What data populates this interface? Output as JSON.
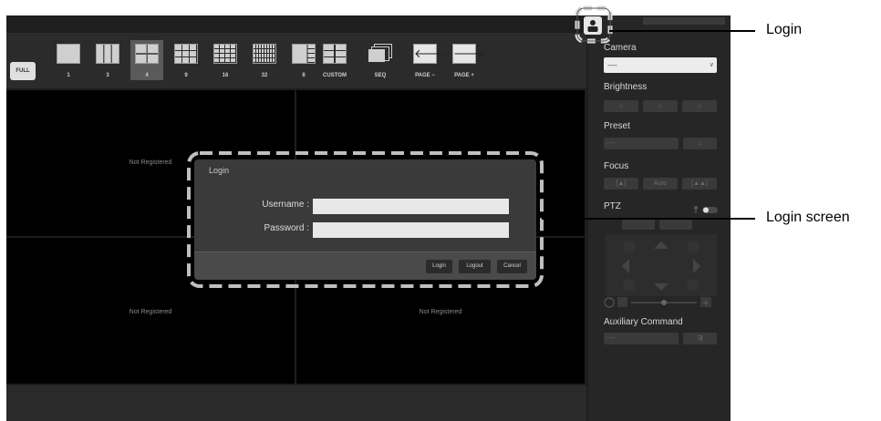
{
  "toolbar": {
    "full_label": "FULL",
    "layouts": [
      {
        "label": "1",
        "icon": "layout-1-icon"
      },
      {
        "label": "3",
        "icon": "layout-3-icon"
      },
      {
        "label": "4",
        "icon": "layout-4-icon",
        "selected": true
      },
      {
        "label": "9",
        "icon": "layout-9-icon"
      },
      {
        "label": "16",
        "icon": "layout-16-icon"
      },
      {
        "label": "32",
        "icon": "layout-32-icon"
      },
      {
        "label": "8",
        "icon": "layout-8-icon"
      },
      {
        "label": "CUSTOM",
        "icon": "layout-custom-icon"
      },
      {
        "label": "SEQ",
        "icon": "sequence-icon"
      },
      {
        "label": "PAGE −",
        "icon": "page-prev-icon"
      },
      {
        "label": "PAGE +",
        "icon": "page-next-icon"
      }
    ]
  },
  "grid": {
    "cells": [
      "Not Registered",
      "",
      "Not Registered",
      "Not Registered"
    ]
  },
  "panel": {
    "camera_label": "Camera",
    "camera_value": "----",
    "brightness_label": "Brightness",
    "preset_label": "Preset",
    "preset_value": "----",
    "focus_label": "Focus",
    "focus_auto": "Auto",
    "ptz_label": "PTZ",
    "aux_label": "Auxiliary Command",
    "aux_value": "----"
  },
  "dialog": {
    "title": "Login",
    "username_label": "Username :",
    "password_label": "Password :",
    "username_value": "",
    "password_value": "",
    "login_button": "Login",
    "logout_button": "Logout",
    "cancel_button": "Cancel"
  },
  "callouts": {
    "login": "Login",
    "login_screen": "Login screen"
  },
  "colors": {
    "app_bg": "#1e1e1e",
    "panel_bg": "#262626",
    "dialog_bg": "#3a3a3a",
    "highlight_dash": "#bfbfbf"
  }
}
